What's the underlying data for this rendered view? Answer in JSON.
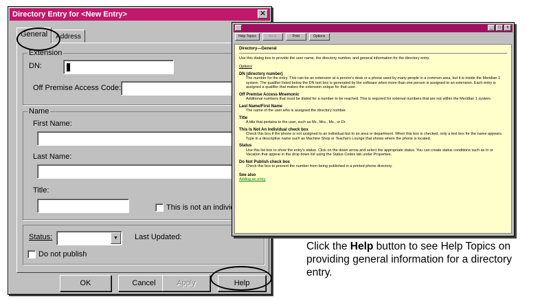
{
  "dialog": {
    "title": "Directory Entry for <New Entry>",
    "close_glyph": "✕",
    "tabs": [
      {
        "label": "General"
      },
      {
        "label": "Address"
      }
    ],
    "extension": {
      "group_label": "Extension",
      "dn_label": "DN:",
      "dn_value": "",
      "opac_label": "Off Premise Access Code:"
    },
    "name": {
      "group_label": "Name",
      "first_name_label": "First Name:",
      "last_name_label": "Last Name:",
      "title_label": "Title:",
      "not_individual_label": "This is not an individu"
    },
    "status_label": "Status:",
    "last_updated_label": "Last Updated:",
    "do_not_publish_label": "Do not publish",
    "buttons": {
      "ok": "OK",
      "cancel": "Cancel",
      "apply": "Apply",
      "help": "Help"
    }
  },
  "help_window": {
    "toolbar": [
      "Help Topics",
      "Back",
      "Print",
      "Options"
    ],
    "heading": "Directory—General",
    "intro": "Use this dialog box to provide the user name, the directory number, and general information for the directory entry.",
    "options_label": "Options",
    "sections": [
      {
        "title": "DN (directory number)",
        "text": "The number for the entry. This can be an extension at a person's desk or a phone used by many people in a common area, but it is inside the Meridian 1 system. The qualifier listed below the DN text box is generated by the software when more than one person is assigned to an extension. Each entry is assigned a qualifier that makes the extension unique for that user."
      },
      {
        "title": "Off Premise Access Mnemonic",
        "text": "Additional numbers that must be dialed for a number to be reached. This is required for external numbers that are not within the Meridian 1 system."
      },
      {
        "title": "Last Name/First Name",
        "text": "The name of the user who is assigned the directory number."
      },
      {
        "title": "Title",
        "text": "A title that pertains to the user, such as Mr., Mrs., Ms., or Dr."
      },
      {
        "title": "This Is Not An Individual check box",
        "text": "Check this box if the phone is not assigned to an individual but to an area or department. When this box is checked, only a text box for the name appears. Type in a descriptive name such as Machine Shop or Teachers Lounge that shows where the phone is located."
      },
      {
        "title": "Status",
        "text": "Use this list box to show the entry's status. Click on the down arrow and select the appropriate status. You can create status conditions such as In or Vacation that appear in the drop down list using the Status Codes tab under Properties."
      },
      {
        "title": "Do Not Publish check box",
        "text": "Check this box to prevent the number from being published in a printed phone directory."
      }
    ],
    "see_also_label": "See also",
    "see_also_link": "Adding an entry"
  },
  "caption": {
    "prefix": "Click the ",
    "bold": "Help",
    "suffix": " button to see Help Topics on providing general information for a directory entry."
  }
}
